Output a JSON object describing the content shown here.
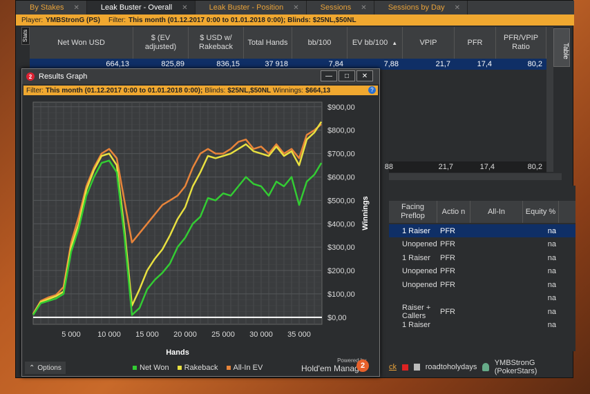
{
  "tabs": [
    {
      "label": "By Stakes",
      "active": false
    },
    {
      "label": "Leak Buster - Overall",
      "active": true
    },
    {
      "label": "Leak Buster - Position",
      "active": false
    },
    {
      "label": "Sessions",
      "active": false
    },
    {
      "label": "Sessions by Day",
      "active": false
    }
  ],
  "filter": {
    "player_label": "Player:",
    "player": "YMBStronG (PS)",
    "filter_label": "Filter:",
    "filter": "This month (01.12.2017 0:00 to 01.01.2018 0:00); Blinds: $25NL,$50NL"
  },
  "side_tabs": {
    "stats": "Stats",
    "table": "Table"
  },
  "table": {
    "headers": [
      "Net Won USD",
      "$ (EV adjusted)",
      "$ USD w/ Rakeback",
      "Total Hands",
      "bb/100",
      "EV bb/100",
      "VPIP",
      "PFR",
      "PFR/VPIP Ratio"
    ],
    "sort_indicator": "▲",
    "row": [
      "664,13",
      "825,89",
      "836,15",
      "37 918",
      "7,84",
      "7,88",
      "21,7",
      "17,4",
      "80,2"
    ],
    "summary": [
      "88",
      "21,7",
      "17,4",
      "80,2"
    ]
  },
  "lower_table": {
    "headers": [
      "Facing Preflop",
      "Actio n",
      "All-In",
      "Equity %"
    ],
    "rows": [
      {
        "facing": "1 Raiser",
        "action": "PFR",
        "equity": "na",
        "selected": true
      },
      {
        "facing": "Unopened",
        "action": "PFR",
        "equity": "na",
        "selected": false
      },
      {
        "facing": "1 Raiser",
        "action": "PFR",
        "equity": "na",
        "selected": false
      },
      {
        "facing": "Unopened",
        "action": "PFR",
        "equity": "na",
        "selected": false
      },
      {
        "facing": "Unopened",
        "action": "PFR",
        "equity": "na",
        "selected": false
      },
      {
        "facing": "",
        "action": "",
        "equity": "na",
        "selected": false
      },
      {
        "facing": "Raiser + Callers",
        "action": "PFR",
        "equity": "na",
        "selected": false
      },
      {
        "facing": "1 Raiser",
        "action": "",
        "equity": "na",
        "selected": false
      }
    ]
  },
  "status": {
    "partial": "ck",
    "tag": "roadtoholydays",
    "player": "YMBStronG (PokerStars)"
  },
  "window": {
    "title": "Results Graph",
    "logo": "2",
    "filter_label": "Filter:",
    "filter": "This month (01.12.2017 0:00 to 01.01.2018 0:00);",
    "blinds_label": "Blinds:",
    "blinds": "$25NL,$50NL",
    "winnings_label": "Winnings:",
    "winnings": "$664,13",
    "options": "Options",
    "powered_by": "Powered by",
    "brand": "Hold'em Manager",
    "brand_logo": "2"
  },
  "colors": {
    "net_won": "#33cc33",
    "rakeback": "#e8e040",
    "allin_ev": "#e8843a",
    "zero_line": "#ffffff",
    "accent": "#f0a830"
  },
  "chart_data": {
    "type": "line",
    "xlabel": "Hands",
    "ylabel": "Winnings",
    "xticks": [
      "5 000",
      "10 000",
      "15 000",
      "20 000",
      "25 000",
      "30 000",
      "35 000"
    ],
    "xtick_values": [
      5000,
      10000,
      15000,
      20000,
      25000,
      30000,
      35000
    ],
    "yticks": [
      "$0,00",
      "$100,00",
      "$200,00",
      "$300,00",
      "$400,00",
      "$500,00",
      "$600,00",
      "$700,00",
      "$800,00",
      "$900,00"
    ],
    "xlim": [
      0,
      38000
    ],
    "ylim": [
      -30,
      920
    ],
    "grid": true,
    "legend_position": "bottom",
    "x": [
      0,
      1000,
      2000,
      3000,
      4000,
      5000,
      6000,
      7000,
      8000,
      9000,
      10000,
      11000,
      12000,
      13000,
      14000,
      15000,
      16000,
      17000,
      18000,
      19000,
      20000,
      21000,
      22000,
      23000,
      24000,
      25000,
      26000,
      27000,
      28000,
      29000,
      30000,
      31000,
      32000,
      33000,
      34000,
      35000,
      36000,
      37000,
      37918
    ],
    "series": [
      {
        "name": "Net Won",
        "color": "#33cc33",
        "values": [
          10,
          60,
          70,
          80,
          100,
          280,
          380,
          520,
          600,
          660,
          670,
          620,
          350,
          10,
          40,
          120,
          160,
          190,
          230,
          300,
          340,
          400,
          430,
          510,
          500,
          530,
          520,
          560,
          600,
          570,
          560,
          520,
          580,
          560,
          600,
          480,
          580,
          610,
          660
        ]
      },
      {
        "name": "Rakeback",
        "color": "#e8e040",
        "values": [
          12,
          65,
          78,
          90,
          110,
          300,
          400,
          545,
          630,
          690,
          700,
          650,
          380,
          50,
          120,
          200,
          250,
          290,
          350,
          420,
          470,
          560,
          620,
          690,
          680,
          690,
          700,
          720,
          740,
          710,
          700,
          690,
          730,
          690,
          710,
          650,
          760,
          790,
          836
        ]
      },
      {
        "name": "All-In EV",
        "color": "#e8843a",
        "values": [
          15,
          70,
          85,
          95,
          130,
          320,
          430,
          560,
          640,
          700,
          720,
          680,
          500,
          320,
          360,
          400,
          440,
          480,
          500,
          520,
          560,
          640,
          700,
          720,
          700,
          700,
          720,
          750,
          760,
          720,
          730,
          700,
          740,
          700,
          720,
          680,
          780,
          800,
          826
        ]
      }
    ]
  }
}
